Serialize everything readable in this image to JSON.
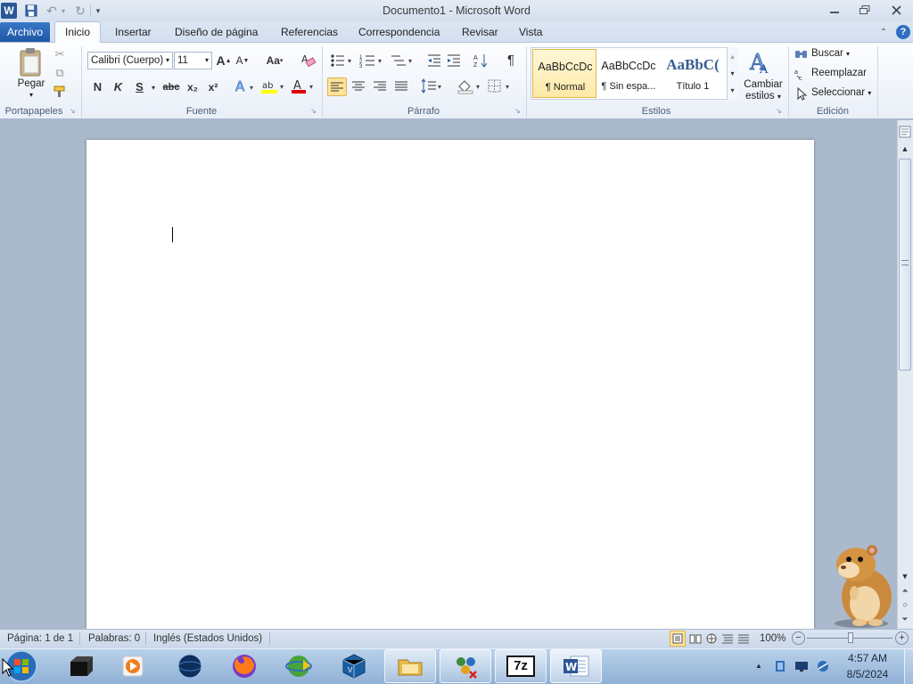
{
  "window": {
    "title": "Documento1 - Microsoft Word"
  },
  "qat": {
    "undo": "↶",
    "redo": "↻"
  },
  "tabs": {
    "file": "Archivo",
    "home": "Inicio",
    "insert": "Insertar",
    "layout": "Diseño de página",
    "references": "Referencias",
    "mailings": "Correspondencia",
    "review": "Revisar",
    "view": "Vista"
  },
  "clipboard": {
    "paste": "Pegar",
    "label": "Portapapeles"
  },
  "font": {
    "family": "Calibri (Cuerpo)",
    "size": "11",
    "grow": "A",
    "shrink": "A",
    "case": "Aa",
    "bold": "N",
    "italic": "K",
    "underline": "S",
    "strike": "abc",
    "subscript": "x₂",
    "superscript": "x²",
    "label": "Fuente"
  },
  "paragraph": {
    "pilcrow": "¶",
    "label": "Párrafo"
  },
  "styles": {
    "items": [
      {
        "sample": "AaBbCcDc",
        "name": "¶ Normal"
      },
      {
        "sample": "AaBbCcDc",
        "name": "¶ Sin espa..."
      },
      {
        "sample": "AaBbC(",
        "name": "Título 1"
      }
    ],
    "change_label_1": "Cambiar",
    "change_label_2": "estilos",
    "label": "Estilos"
  },
  "editing": {
    "find": "Buscar",
    "replace": "Reemplazar",
    "select": "Seleccionar",
    "label": "Edición"
  },
  "status": {
    "page": "Página: 1 de 1",
    "words": "Palabras: 0",
    "language": "Inglés (Estados Unidos)",
    "zoom": "100%"
  },
  "taskbar": {
    "time": "4:57 AM",
    "date": "8/5/2024",
    "seven_zip": "7z"
  },
  "colors": {
    "accent": "#2b5797",
    "file_tab": "#2a66b8",
    "highlight": "#ffff00",
    "font_color": "#e00000"
  }
}
